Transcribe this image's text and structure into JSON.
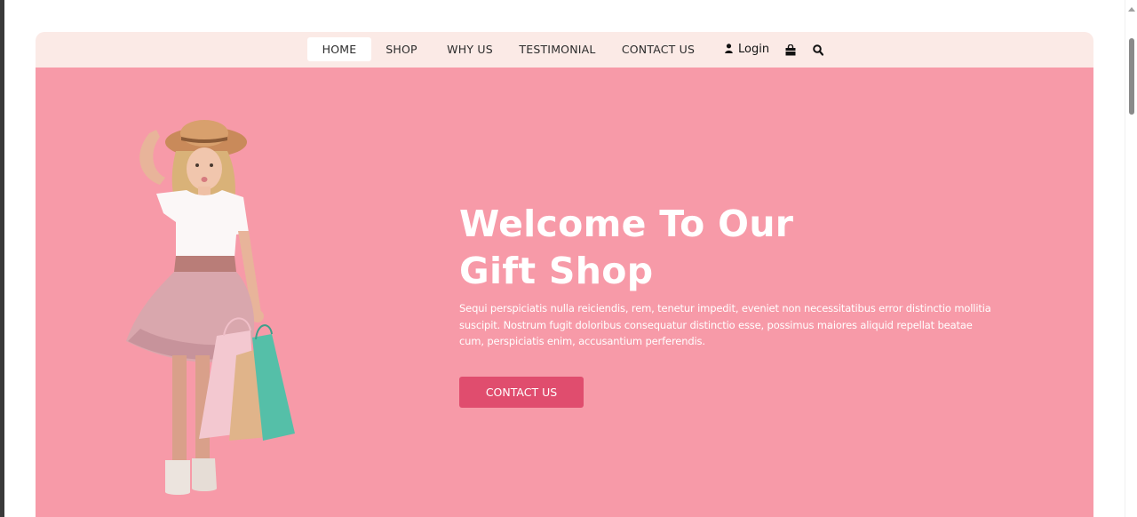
{
  "nav": {
    "items": [
      {
        "label": "HOME",
        "active": true
      },
      {
        "label": "SHOP",
        "active": false
      },
      {
        "label": "WHY US",
        "active": false
      },
      {
        "label": "TESTIMONIAL",
        "active": false
      },
      {
        "label": "CONTACT US",
        "active": false
      }
    ],
    "login_label": "Login",
    "icons": [
      "user-icon",
      "shopping-bag-icon",
      "search-icon"
    ]
  },
  "hero": {
    "title_line1": "Welcome To Our",
    "title_line2": "Gift Shop",
    "description": "Sequi perspiciatis nulla reiciendis, rem, tenetur impedit, eveniet non necessitatibus error distinctio mollitia suscipit. Nostrum fugit doloribus consequatur distinctio esse, possimus maiores aliquid repellat beatae cum, perspiciatis enim, accusantium perferendis.",
    "button_label": "CONTACT US"
  },
  "colors": {
    "navbar_bg": "#fbeae6",
    "hero_bg": "#f79aa8",
    "button_bg": "#e04d6e",
    "text_on_hero": "#ffffff"
  }
}
